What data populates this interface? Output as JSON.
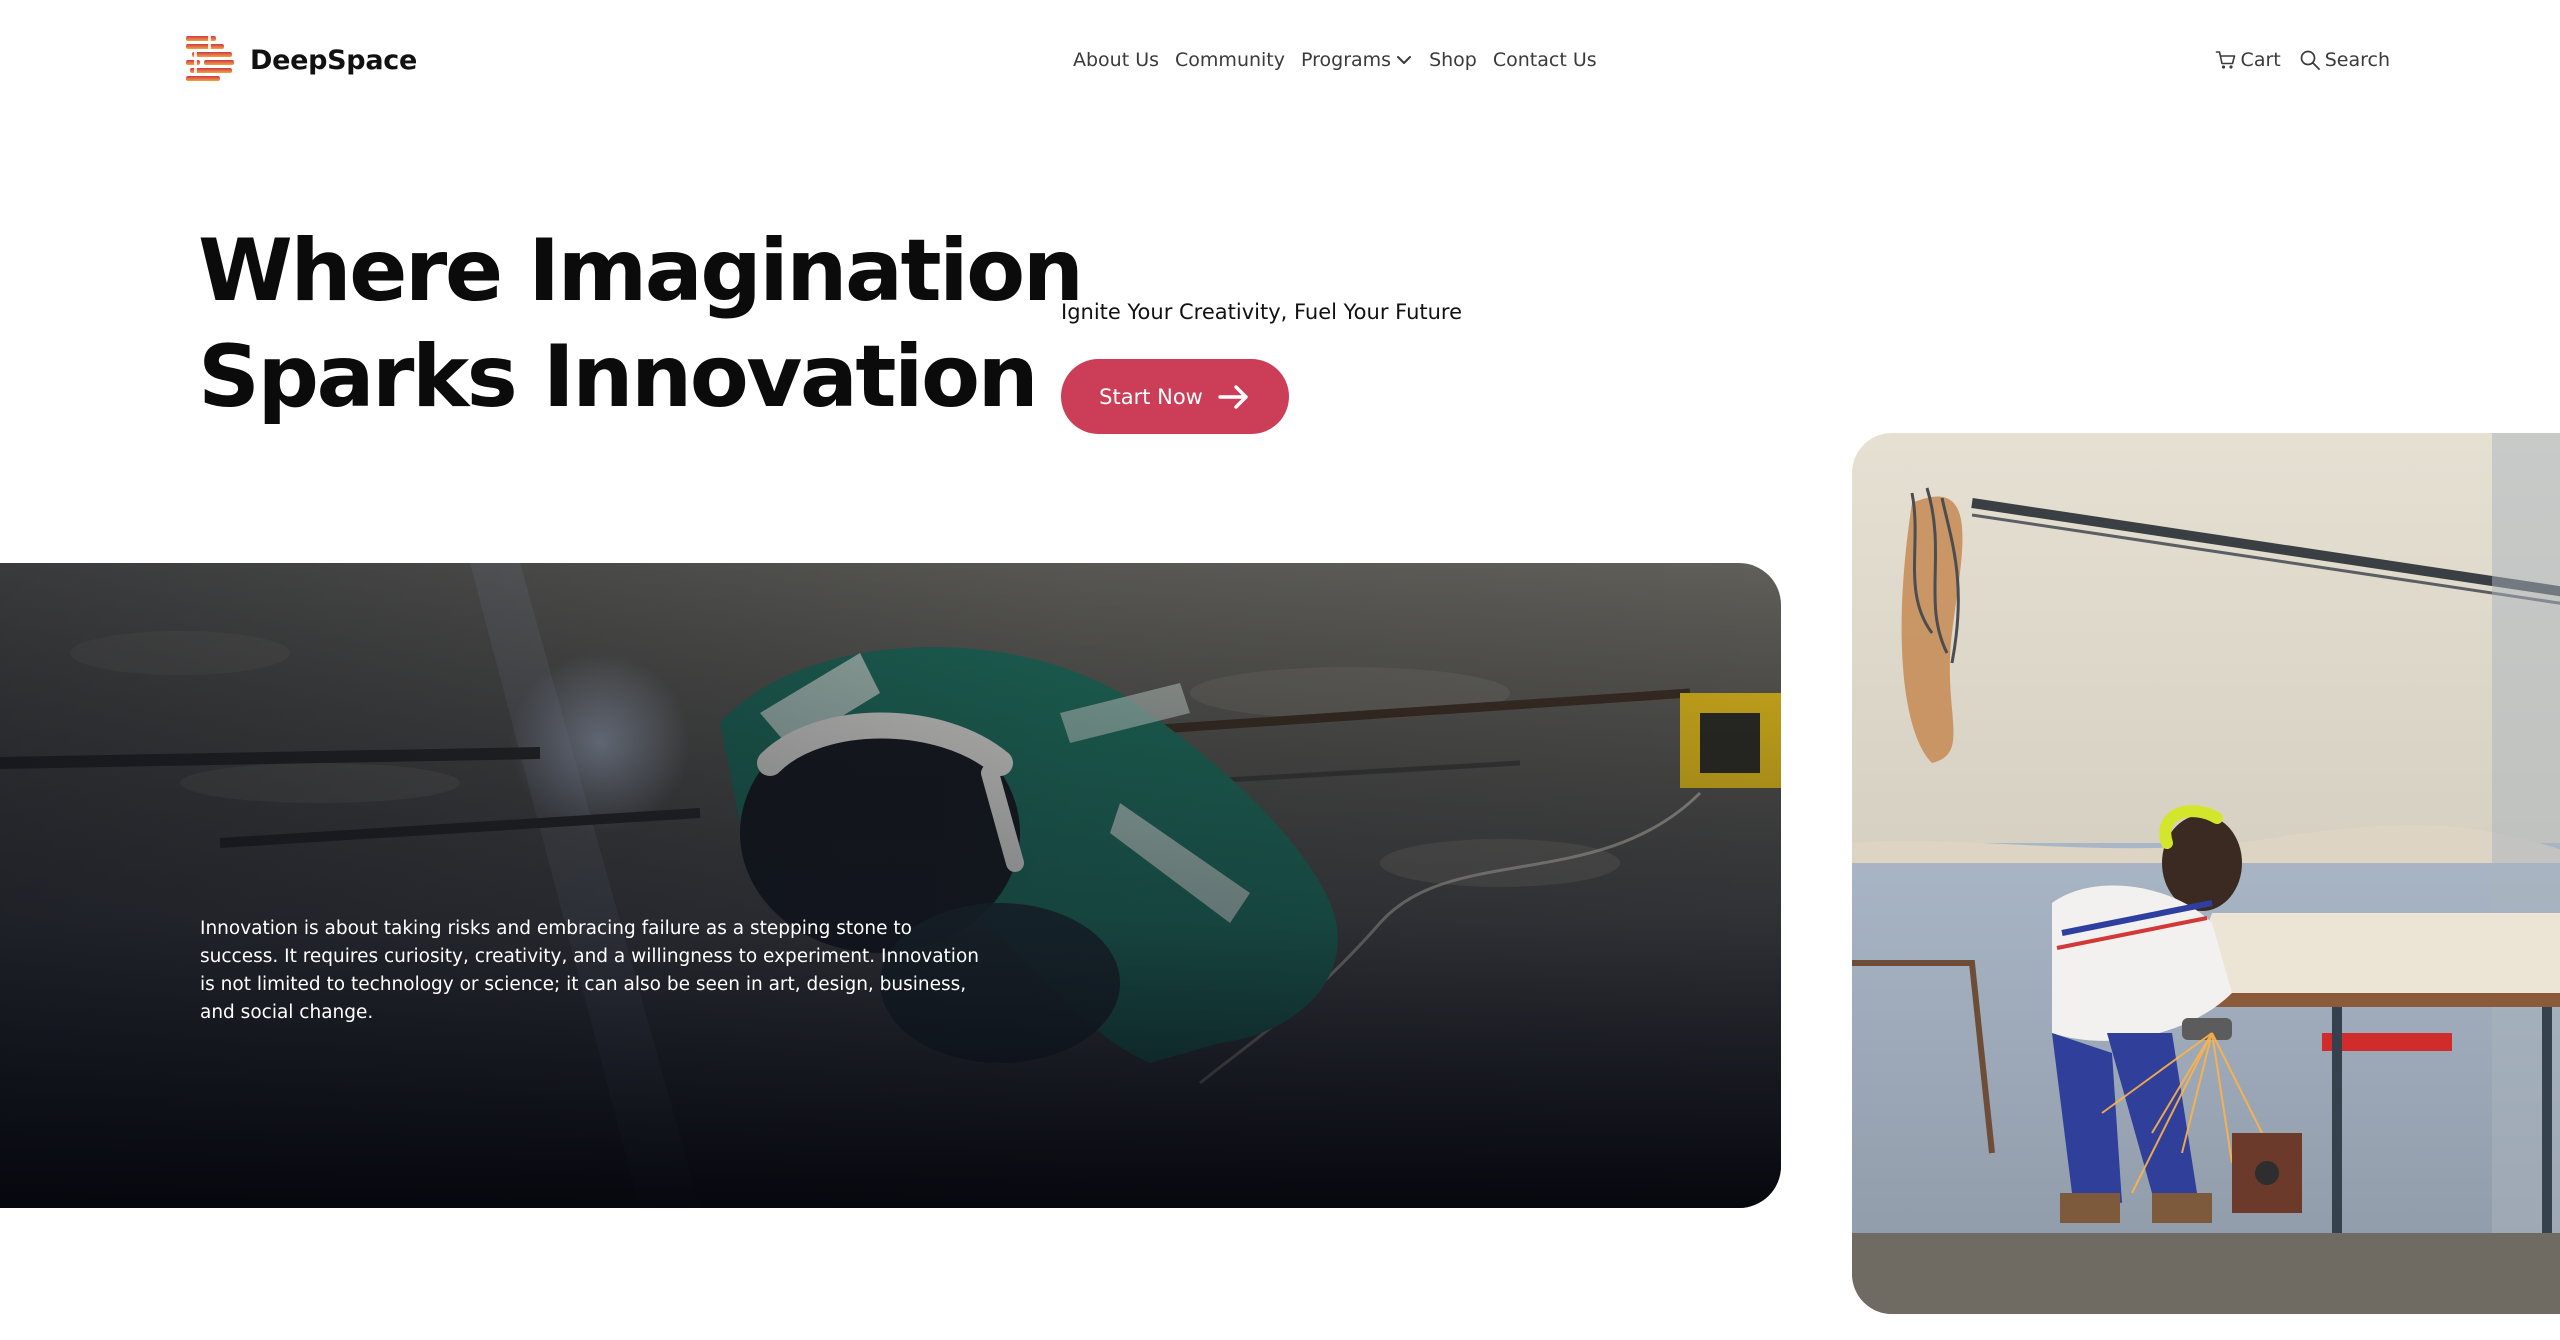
{
  "brand": {
    "name": "DeepSpace"
  },
  "nav": {
    "items": [
      {
        "label": "About Us"
      },
      {
        "label": "Community"
      },
      {
        "label": "Programs"
      },
      {
        "label": "Shop"
      },
      {
        "label": "Contact Us"
      }
    ]
  },
  "utils": {
    "cart_label": "Cart",
    "search_label": "Search"
  },
  "hero": {
    "title_line1": "Where Imagination",
    "title_line2": "Sparks Innovation",
    "subtitle": "Ignite Your Creativity, Fuel Your Future",
    "cta_label": "Start Now"
  },
  "feature": {
    "body": "Innovation is about taking risks and embracing failure as a stepping stone to success. It requires curiosity, creativity, and a willingness to experiment. Innovation is not limited to technology or science; it can also be seen in art, design, business, and social change."
  },
  "colors": {
    "accent": "#cc3d57",
    "text": "#111111",
    "background": "#ffffff"
  },
  "icons": {
    "logo": "deepspace-logo-icon",
    "programs": "chevron-down-icon",
    "cart": "cart-icon",
    "search": "search-icon",
    "cta": "arrow-right-icon"
  }
}
